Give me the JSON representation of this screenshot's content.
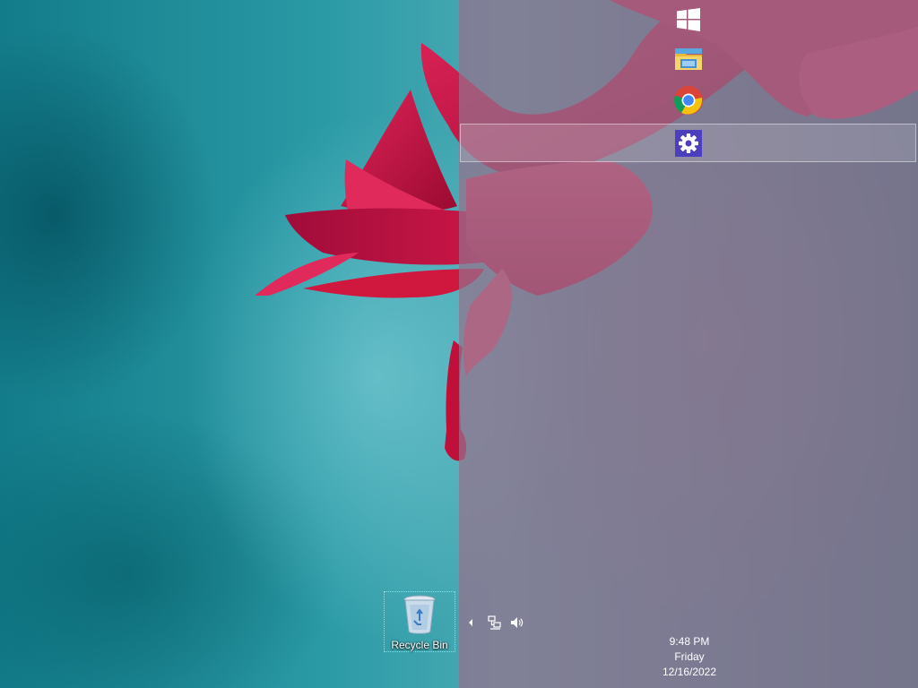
{
  "desktop": {
    "background_colors": {
      "teal": "#2a9aa5",
      "flower_magenta": "#c8103f",
      "panel_overlay": "#96708c"
    },
    "icons": [
      {
        "label": "Recycle Bin",
        "icon": "recycle-bin-icon"
      }
    ]
  },
  "start_panel": {
    "apps": [
      {
        "name": "Start",
        "icon": "windows-logo-icon"
      },
      {
        "name": "File Explorer",
        "icon": "file-explorer-icon"
      },
      {
        "name": "Google Chrome",
        "icon": "chrome-icon"
      },
      {
        "name": "Settings",
        "icon": "settings-gear-icon",
        "selected": true
      }
    ]
  },
  "system_tray": {
    "icons": [
      "show-hidden-icons-arrow-icon",
      "network-icon",
      "volume-icon"
    ],
    "clock": {
      "time": "9:48 PM",
      "day": "Friday",
      "date": "12/16/2022"
    }
  }
}
